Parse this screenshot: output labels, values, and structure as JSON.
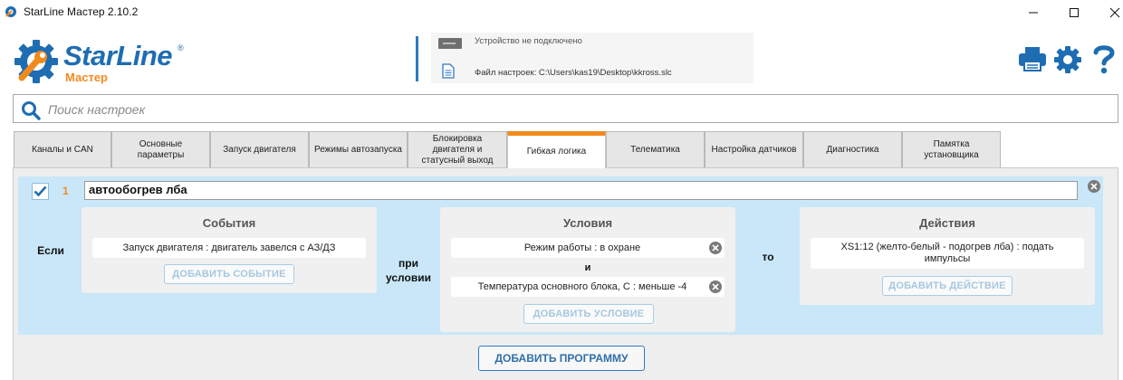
{
  "window": {
    "title": "StarLine Мастер 2.10.2"
  },
  "header": {
    "brand": "StarLine",
    "brand_sub": "Мастер",
    "trademark": "®",
    "device_status": "Устройство не подключено",
    "settings_file": "Файл настроек: C:\\Users\\kas19\\Desktop\\kkross.slc"
  },
  "search": {
    "placeholder": "Поиск настроек"
  },
  "tabs": [
    {
      "label": "Каналы и CAN"
    },
    {
      "label": "Основные параметры"
    },
    {
      "label": "Запуск двигателя"
    },
    {
      "label": "Режимы автозапуска"
    },
    {
      "label": "Блокировка двигателя и статусный выход"
    },
    {
      "label": "Гибкая логика",
      "active": true
    },
    {
      "label": "Телематика"
    },
    {
      "label": "Настройка датчиков"
    },
    {
      "label": "Диагностика"
    },
    {
      "label": "Памятка установщика"
    }
  ],
  "program": {
    "number": "1",
    "name": "автообогрев лба",
    "enabled": true,
    "if_label": "Если",
    "while_label": "при условии",
    "then_label": "то",
    "events": {
      "title": "События",
      "items": [
        "Запуск двигателя : двигатель завелся с АЗ/ДЗ"
      ],
      "add_label": "ДОБАВИТЬ СОБЫТИЕ"
    },
    "conditions": {
      "title": "Условия",
      "items": [
        "Режим работы : в охране",
        "Температура основного блока, С : меньше -4"
      ],
      "joiner": "и",
      "add_label": "ДОБАВИТЬ УСЛОВИЕ"
    },
    "actions": {
      "title": "Действия",
      "items": [
        "XS1:12 (желто-белый - подогрев лба) : подать импульсы"
      ],
      "add_label": "ДОБАВИТЬ ДЕЙСТВИЕ"
    }
  },
  "add_program_label": "ДОБАВИТЬ ПРОГРАММУ",
  "colors": {
    "accent_blue": "#1e6db2",
    "accent_orange": "#f18a1d",
    "program_bg": "#c9e7f8"
  }
}
